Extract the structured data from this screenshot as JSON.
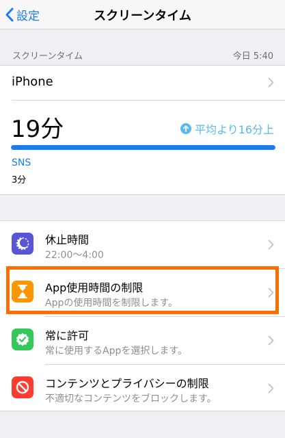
{
  "nav": {
    "back_label": "設定",
    "title": "スクリーンタイム"
  },
  "summary_header": {
    "label": "スクリーンタイム",
    "timestamp": "今日 5:40"
  },
  "device": {
    "name": "iPhone"
  },
  "usage": {
    "total": "19分",
    "comparison": "平均より16分上",
    "bar_fraction": 1.0,
    "category": {
      "name": "SNS",
      "time": "3分"
    }
  },
  "settings": [
    {
      "title": "休止時間",
      "subtitle": "22:00〜4:00",
      "icon": "downtime-icon",
      "color": "#5856d6"
    },
    {
      "title": "App使用時間の制限",
      "subtitle": "Appの使用時間を制限します。",
      "icon": "hourglass-icon",
      "color": "#ff9500"
    },
    {
      "title": "常に許可",
      "subtitle": "常に使用するAppを選択します。",
      "icon": "checkmark-badge-icon",
      "color": "#34c759"
    },
    {
      "title": "コンテンツとプライバシーの制限",
      "subtitle": "不適切なコンテンツをブロックします。",
      "icon": "restriction-icon",
      "color": "#ff3b30"
    }
  ],
  "colors": {
    "accent": "#1a7cf4",
    "comparison": "#5ab8f0",
    "highlight": "#ff6d00"
  }
}
